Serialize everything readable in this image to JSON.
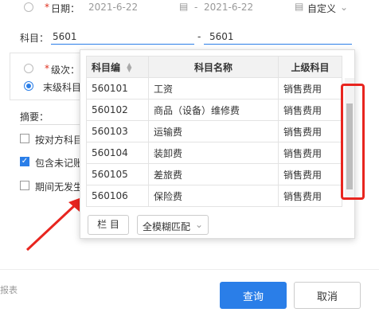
{
  "date_row": {
    "label": "日期：",
    "required_mark": "*",
    "start_date": "2021-6-22",
    "separator": "-",
    "end_date": "2021-6-22",
    "period_select": "自定义"
  },
  "subject_range": {
    "label": "科目：",
    "from": "5601",
    "separator": "-",
    "to": "5601"
  },
  "level_row": {
    "required_mark": "*",
    "label": "级次：",
    "leaf_label": "末级科目"
  },
  "summary_label": "摘要：",
  "options": [
    {
      "label": "按对方科目",
      "checked": false
    },
    {
      "label": "包含未记账",
      "checked": true
    },
    {
      "label": "期间无发生",
      "checked": false
    }
  ],
  "dropdown": {
    "headers": [
      "科目编",
      "科目名称",
      "上级科目"
    ],
    "rows": [
      {
        "code": "560101",
        "name": "工资",
        "parent": "销售费用"
      },
      {
        "code": "560102",
        "name": "商品（设备）维修费",
        "parent": "销售费用"
      },
      {
        "code": "560103",
        "name": "运输费",
        "parent": "销售费用"
      },
      {
        "code": "560104",
        "name": "装卸费",
        "parent": "销售费用"
      },
      {
        "code": "560105",
        "name": "差旅费",
        "parent": "销售费用"
      },
      {
        "code": "560106",
        "name": "保险费",
        "parent": "销售费用"
      }
    ],
    "column_button": "栏 目",
    "match_select": "全模糊匹配"
  },
  "footer": {
    "left_text": "报表",
    "query_button": "查询",
    "cancel_button": "取消"
  },
  "colors": {
    "primary": "#2a7ee8",
    "annotation_red": "#e8251f"
  },
  "icons": [
    "calendar-icon",
    "chevron-down-icon",
    "sort-icon",
    "arrow-annotation"
  ]
}
